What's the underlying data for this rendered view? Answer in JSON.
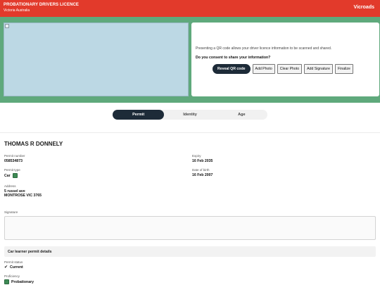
{
  "header": {
    "title": "PROBATIONARY DRIVERS LICENCE",
    "subtitle": "Victoria Australia",
    "brand": "Vicroads",
    "background_color": "#e23a2b"
  },
  "qr_panel": {
    "info_text": "Presenting a QR code allows your driver licence information to be scanned and shared.",
    "consent_question": "Do you consent to share your information?",
    "buttons": {
      "reveal": "Reveal QR code",
      "add_photo": "Add Photo",
      "clear_photo": "Clear Photo",
      "add_signature": "Add Signature",
      "finalize": "Finalize"
    }
  },
  "tabs": [
    {
      "label": "Permit",
      "active": true
    },
    {
      "label": "Identity",
      "active": false
    },
    {
      "label": "Age",
      "active": false
    }
  ],
  "holder": {
    "name": "THOMAS R DONNELY"
  },
  "fields": {
    "permit_number": {
      "label": "Permit number",
      "value": "058534873"
    },
    "permit_type": {
      "label": "Permit type",
      "value": "Car"
    },
    "address": {
      "label": "Address",
      "line1": "5 russel ave",
      "line2": "MONTROSE VIC 3765"
    },
    "expiry": {
      "label": "Expiry",
      "value": "16 Feb 2035"
    },
    "date_of_birth": {
      "label": "Date of birth",
      "value": "16 Feb 2007"
    },
    "signature": {
      "label": "Signature"
    }
  },
  "learner_section": {
    "title": "Car learner permit details",
    "permit_status": {
      "label": "Permit status",
      "value": "Current",
      "icon": "check-icon"
    },
    "proficiency": {
      "label": "Proficiency",
      "value": "Probationary"
    }
  },
  "colors": {
    "accent_green": "#5fa97c",
    "dark_navy": "#1d2b38"
  }
}
